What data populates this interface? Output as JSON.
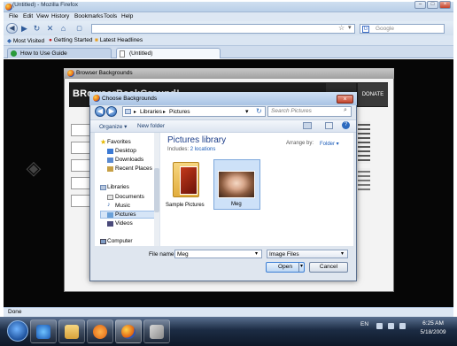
{
  "firefox": {
    "title": "(Untitled) - Mozilla Firefox",
    "menu": [
      "File",
      "Edit",
      "View",
      "History",
      "Bookmarks",
      "Tools",
      "Help"
    ],
    "search_placeholder": "Google",
    "bookmarks": [
      "Most Visited",
      "Getting Started",
      "Latest Headlines"
    ],
    "tabs": [
      {
        "label": "How to Use Guide",
        "active": false
      },
      {
        "label": "(Untitled)",
        "active": true
      }
    ],
    "status": "Done"
  },
  "background_window": {
    "title": "Browser Backgrounds",
    "header_title": "BRowserBackGround!",
    "donate": "DONATE"
  },
  "dialog": {
    "title": "Choose Backgrounds",
    "breadcrumb": [
      "Libraries",
      "Pictures"
    ],
    "search_placeholder": "Search Pictures",
    "toolbar": {
      "organize": "Organize",
      "new_folder": "New folder"
    },
    "nav": {
      "favorites_header": "Favorites",
      "favorites": [
        "Desktop",
        "Downloads",
        "Recent Places"
      ],
      "libraries_header": "Libraries",
      "libraries": [
        "Documents",
        "Music",
        "Pictures",
        "Videos"
      ],
      "selected": "Pictures",
      "computer": "Computer"
    },
    "library": {
      "title": "Pictures library",
      "includes_label": "Includes:",
      "includes_link": "2 locations",
      "arrange_label": "Arrange by:",
      "arrange_value": "Folder"
    },
    "items": [
      {
        "label": "Sample Pictures",
        "type": "folder"
      },
      {
        "label": "Meg",
        "type": "image",
        "selected": true
      }
    ],
    "file_name_label": "File name:",
    "file_name_value": "Meg",
    "file_type": "Image Files",
    "open": "Open",
    "cancel": "Cancel"
  },
  "taskbar": {
    "lang": "EN",
    "time": "6:25 AM",
    "date": "5/18/2009"
  },
  "colors": {
    "accent": "#1e3f8a",
    "selection": "#cde1f8",
    "page_background": "#060606"
  }
}
